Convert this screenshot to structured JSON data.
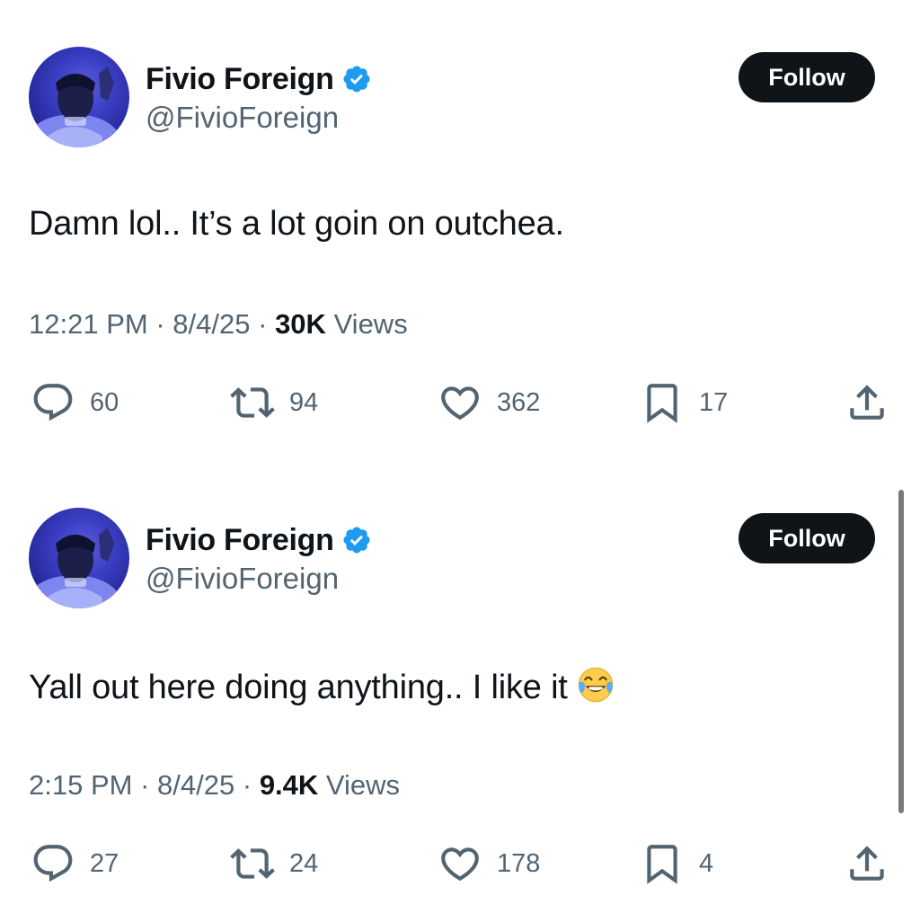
{
  "tweets": [
    {
      "author": {
        "display_name": "Fivio Foreign",
        "handle": "@FivioForeign",
        "verified": true,
        "verified_icon": "verified-badge-icon",
        "verified_color": "#1d9bf0"
      },
      "follow_label": "Follow",
      "text": "Damn lol.. It’s a lot goin on outchea.",
      "emoji": "",
      "time": "12:21 PM",
      "date": "8/4/25",
      "views_count": "30K",
      "views_label": "Views",
      "replies": "60",
      "reposts": "94",
      "likes": "362",
      "bookmarks": "17"
    },
    {
      "author": {
        "display_name": "Fivio Foreign",
        "handle": "@FivioForeign",
        "verified": true,
        "verified_icon": "verified-badge-icon",
        "verified_color": "#1d9bf0"
      },
      "follow_label": "Follow",
      "text": "Yall out here doing anything.. I like it",
      "emoji": "face-with-tears-of-joy",
      "time": "2:15 PM",
      "date": "8/4/25",
      "views_count": "9.4K",
      "views_label": "Views",
      "replies": "27",
      "reposts": "24",
      "likes": "178",
      "bookmarks": "4"
    }
  ],
  "separator": "·",
  "colors": {
    "text": "#0f1419",
    "secondary": "#536471",
    "button_bg": "#0f1419",
    "button_text": "#ffffff",
    "verified": "#1d9bf0"
  },
  "icons": {
    "reply": "reply-icon",
    "repost": "repost-icon",
    "like": "heart-icon",
    "bookmark": "bookmark-icon",
    "share": "share-icon"
  }
}
